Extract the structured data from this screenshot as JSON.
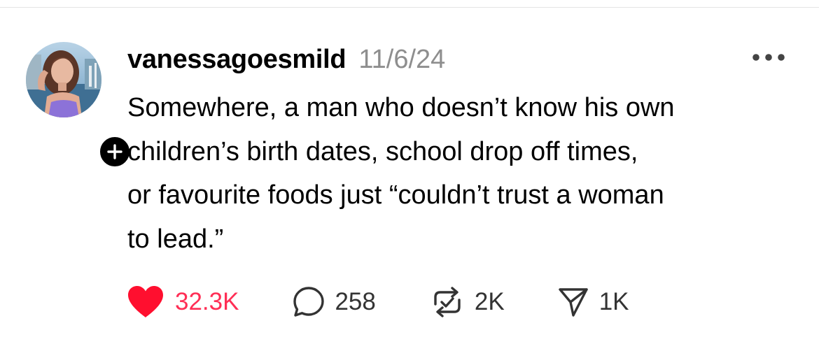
{
  "post": {
    "username": "vanessagoesmild",
    "timestamp": "11/6/24",
    "text": "Somewhere, a man who doesn’t know his own\nchildren’s birth dates, school drop off times,\nor favourite foods just “couldn’t trust a woman\nto lead.”"
  },
  "actions": {
    "likes": "32.3K",
    "comments": "258",
    "reposts": "2K",
    "shares": "1K"
  },
  "colors": {
    "like_red": "#ff2e55",
    "timestamp_gray": "#8e8e8e",
    "badge_black": "#000000"
  },
  "icons": {
    "more": "ellipsis-icon",
    "like": "heart-icon",
    "comment": "comment-bubble-icon",
    "repost": "repost-icon",
    "share": "send-icon",
    "follow": "plus-icon"
  }
}
